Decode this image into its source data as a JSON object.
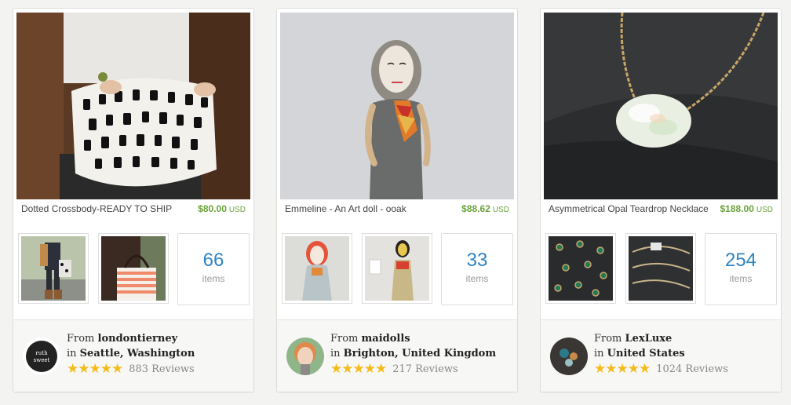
{
  "cards": [
    {
      "title": "Dotted Crossbody-READY TO SHIP",
      "price": "$80.00",
      "currency": "USD",
      "items_count": "66",
      "items_label": "items",
      "shop": {
        "from_label": "From",
        "name": "londontierney",
        "in_label": "in",
        "location": "Seattle, Washington",
        "rating": 5,
        "stars": "★★★★★",
        "reviews": "883 Reviews"
      }
    },
    {
      "title": "Emmeline - An Art doll - ooak",
      "price": "$88.62",
      "currency": "USD",
      "items_count": "33",
      "items_label": "items",
      "shop": {
        "from_label": "From",
        "name": "maidolls",
        "in_label": "in",
        "location": "Brighton, United Kingdom",
        "rating": 5,
        "stars": "★★★★★",
        "reviews": "217 Reviews"
      }
    },
    {
      "title": "Asymmetrical Opal Teardrop Necklace",
      "price": "$188.00",
      "currency": "USD",
      "items_count": "254",
      "items_label": "items",
      "shop": {
        "from_label": "From",
        "name": "LexLuxe",
        "in_label": "in",
        "location": "United States",
        "rating": 5,
        "stars": "★★★★★",
        "reviews": "1024 Reviews"
      }
    }
  ],
  "colors": {
    "price": "#6aa33b",
    "count": "#2f84c2",
    "star": "#f4bc1b"
  }
}
